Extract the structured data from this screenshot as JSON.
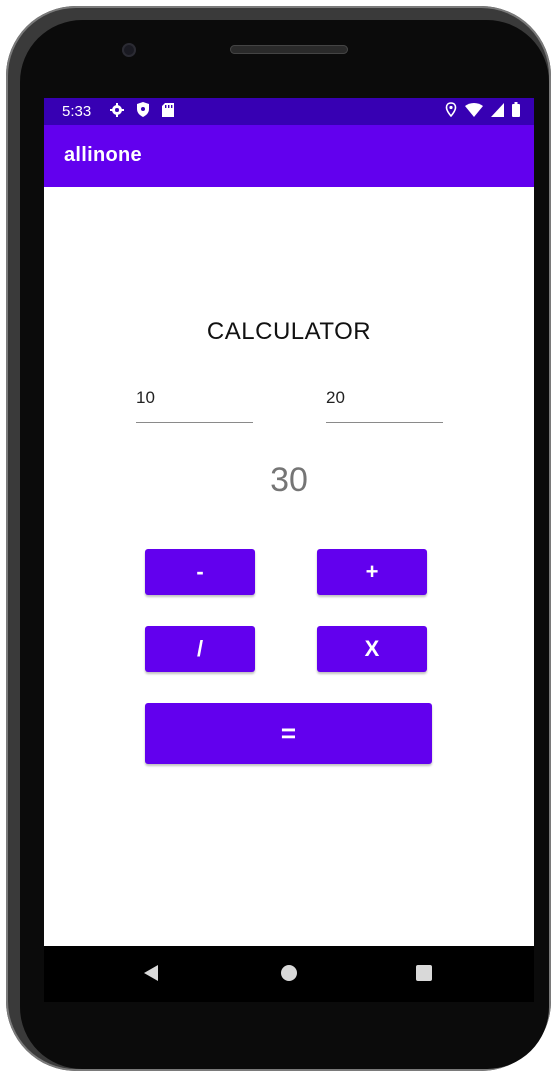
{
  "status_bar": {
    "time": "5:33",
    "left_icons": [
      "gear-icon",
      "shield-icon",
      "sd-card-icon"
    ],
    "right_icons": [
      "location-icon",
      "wifi-icon",
      "signal-icon",
      "battery-icon"
    ],
    "color": "#3700b3"
  },
  "app_bar": {
    "title": "allinone",
    "color": "#6200ee"
  },
  "calculator": {
    "title": "CALCULATOR",
    "input1": "10",
    "input2": "20",
    "result": "30"
  },
  "buttons": {
    "minus": "-",
    "plus": "+",
    "divide": "/",
    "multiply": "X",
    "equals": "=",
    "color": "#6200ee"
  },
  "nav_bar": {
    "icons": [
      "back-icon",
      "home-icon",
      "recents-icon"
    ]
  }
}
